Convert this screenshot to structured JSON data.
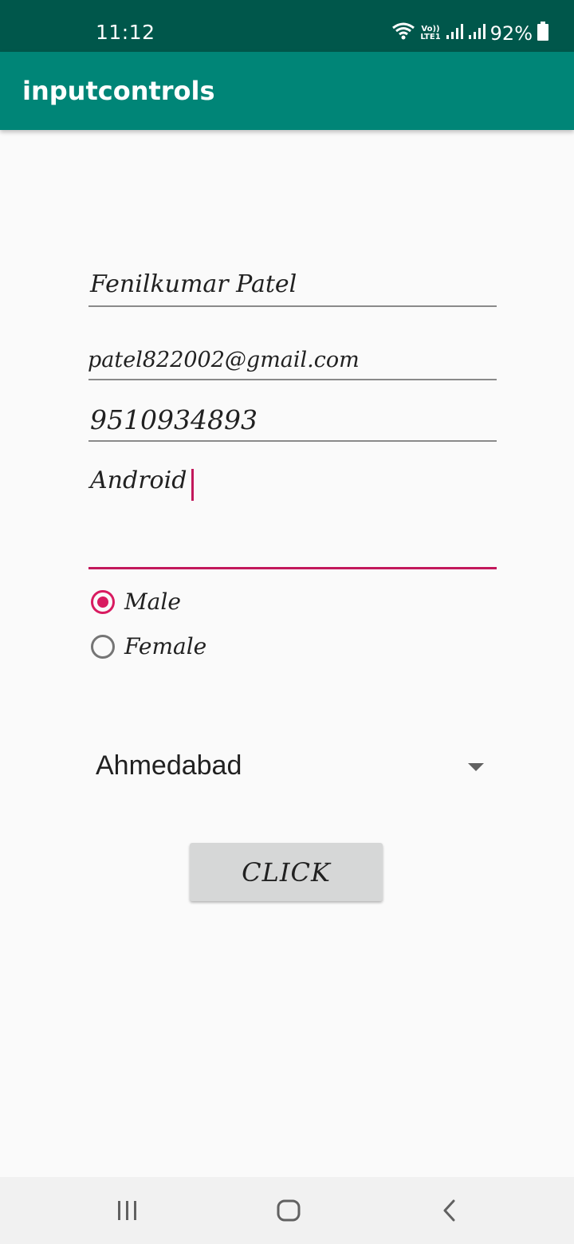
{
  "status_bar": {
    "time": "11:12",
    "network_label": "Vo))\nLTE1",
    "battery": "92%"
  },
  "app_bar": {
    "title": "inputcontrols"
  },
  "form": {
    "name_value": "Fenilkumar Patel",
    "email_value": "patel822002@gmail.com",
    "phone_value": "9510934893",
    "multiline_value": "Android",
    "gender_options": [
      {
        "label": "Male",
        "checked": true
      },
      {
        "label": "Female",
        "checked": false
      }
    ],
    "city_selected": "Ahmedabad",
    "button_label": "CLICK"
  },
  "nav_bar": {
    "icons": [
      "recent-apps-icon",
      "home-icon",
      "back-icon"
    ]
  },
  "colors": {
    "status_bar": "#00574b",
    "app_bar": "#008577",
    "accent": "#d81b60"
  }
}
